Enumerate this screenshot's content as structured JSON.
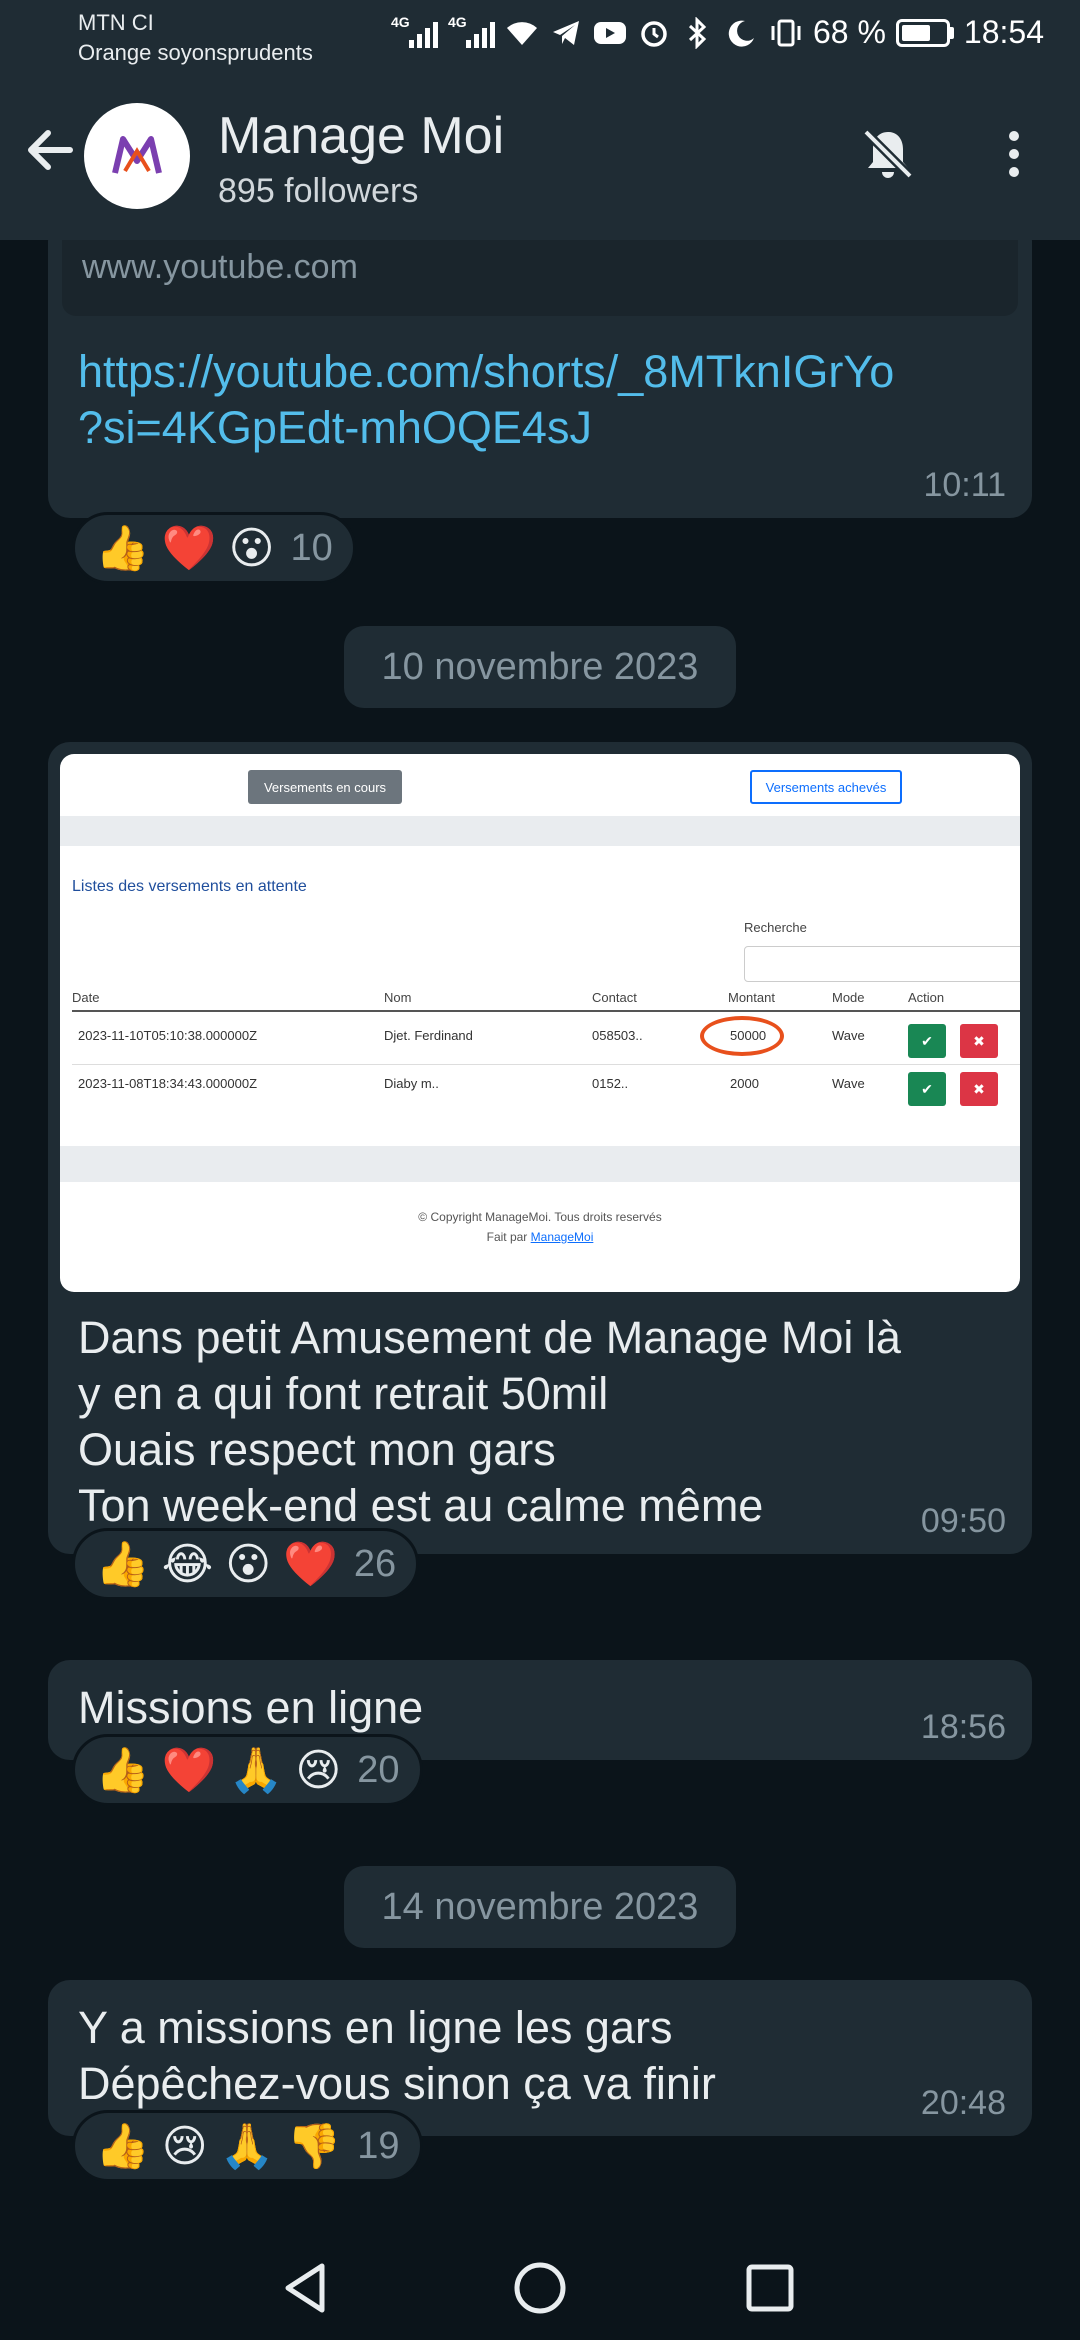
{
  "status": {
    "carrier1": "MTN CI",
    "carrier2": "Orange soyonsprudents",
    "net1": "4G",
    "net2": "4G",
    "battery_pct": "68 %",
    "battery_level": 0.68,
    "time": "18:54"
  },
  "header": {
    "title": "Manage Moi",
    "followers": "895 followers"
  },
  "post1": {
    "site": "www.youtube.com",
    "link": "https://youtube.com/shorts/_8MTknIGrYo?si=4KGpEdt-mhOQE4sJ",
    "link_line1": "https://youtube.com/shorts/_8MTknIGrYo",
    "link_line2": "?si=4KGpEdt-mhOQE4sJ",
    "time": "10:11",
    "reactions": [
      "👍",
      "❤️",
      "😮"
    ],
    "count": "10"
  },
  "date1": "10 novembre 2023",
  "post2": {
    "image": {
      "btn_current": "Versements en cours",
      "btn_done": "Versements achevés",
      "list_title": "Listes des versements en attente",
      "search_label": "Recherche",
      "columns": [
        "Date",
        "Nom",
        "Contact",
        "Montant",
        "Mode",
        "Action"
      ],
      "rows": [
        {
          "date": "2023-11-10T05:10:38.000000Z",
          "nom": "Djet. Ferdinand",
          "contact": "058503..",
          "montant": "50000",
          "mode": "Wave"
        },
        {
          "date": "2023-11-08T18:34:43.000000Z",
          "nom": "Diaby m..",
          "contact": "0152..",
          "montant": "2000",
          "mode": "Wave"
        }
      ],
      "copyright": "© Copyright ManageMoi. Tous droits reservés",
      "fait_par": "Fait par",
      "fait_link": "ManageMoi"
    },
    "lines": [
      "Dans petit Amusement de Manage Moi là",
      "y en a qui font retrait 50mil",
      "Ouais respect mon gars",
      "Ton week-end est au calme même"
    ],
    "time": "09:50",
    "reactions": [
      "👍",
      "😂",
      "😮",
      "❤️"
    ],
    "count": "26"
  },
  "post3": {
    "text": "Missions en ligne",
    "time": "18:56",
    "reactions": [
      "👍",
      "❤️",
      "🙏",
      "😢"
    ],
    "count": "20"
  },
  "date2": "14 novembre 2023",
  "post4": {
    "lines": [
      "Y a missions en ligne les gars",
      "Dépêchez-vous sinon ça va finir"
    ],
    "time": "20:48",
    "reactions": [
      "👍",
      "😢",
      "🙏",
      "👎"
    ],
    "count": "19"
  },
  "icons": {
    "back": "arrow-left-icon",
    "mute": "bell-off-icon",
    "more": "more-vert-icon"
  }
}
